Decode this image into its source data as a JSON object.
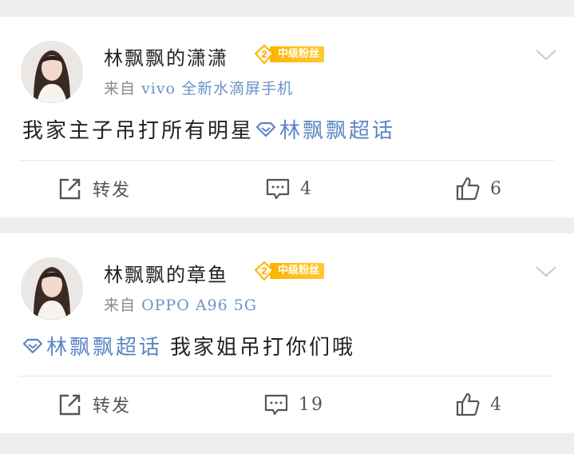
{
  "posts": [
    {
      "username": "林飘飘的潇潇",
      "fan_badge": {
        "level": "2",
        "label": "中级粉丝"
      },
      "source_prefix": "来自",
      "source_device": "vivo 全新水滴屏手机",
      "text_before": "我家主子吊打所有明星",
      "topic": "林飘飘超话",
      "text_after": "",
      "actions": {
        "repost_label": "转发",
        "comment_count": "4",
        "like_count": "6"
      }
    },
    {
      "username": "林飘飘的章鱼",
      "fan_badge": {
        "level": "2",
        "label": "中级粉丝"
      },
      "source_prefix": "来自",
      "source_device": "OPPO A96 5G",
      "text_before": "",
      "topic": "林飘飘超话",
      "text_after": "我家姐吊打你们哦",
      "actions": {
        "repost_label": "转发",
        "comment_count": "19",
        "like_count": "4"
      }
    }
  ],
  "colors": {
    "background": "#eeeeee",
    "card": "#ffffff",
    "link_blue": "#5b86c4",
    "badge_gold": "#ffb300"
  },
  "icons": [
    "avatar",
    "diamond-badge-icon",
    "chevron-down-icon",
    "topic-diamond-icon",
    "repost-icon",
    "comment-icon",
    "like-icon"
  ]
}
